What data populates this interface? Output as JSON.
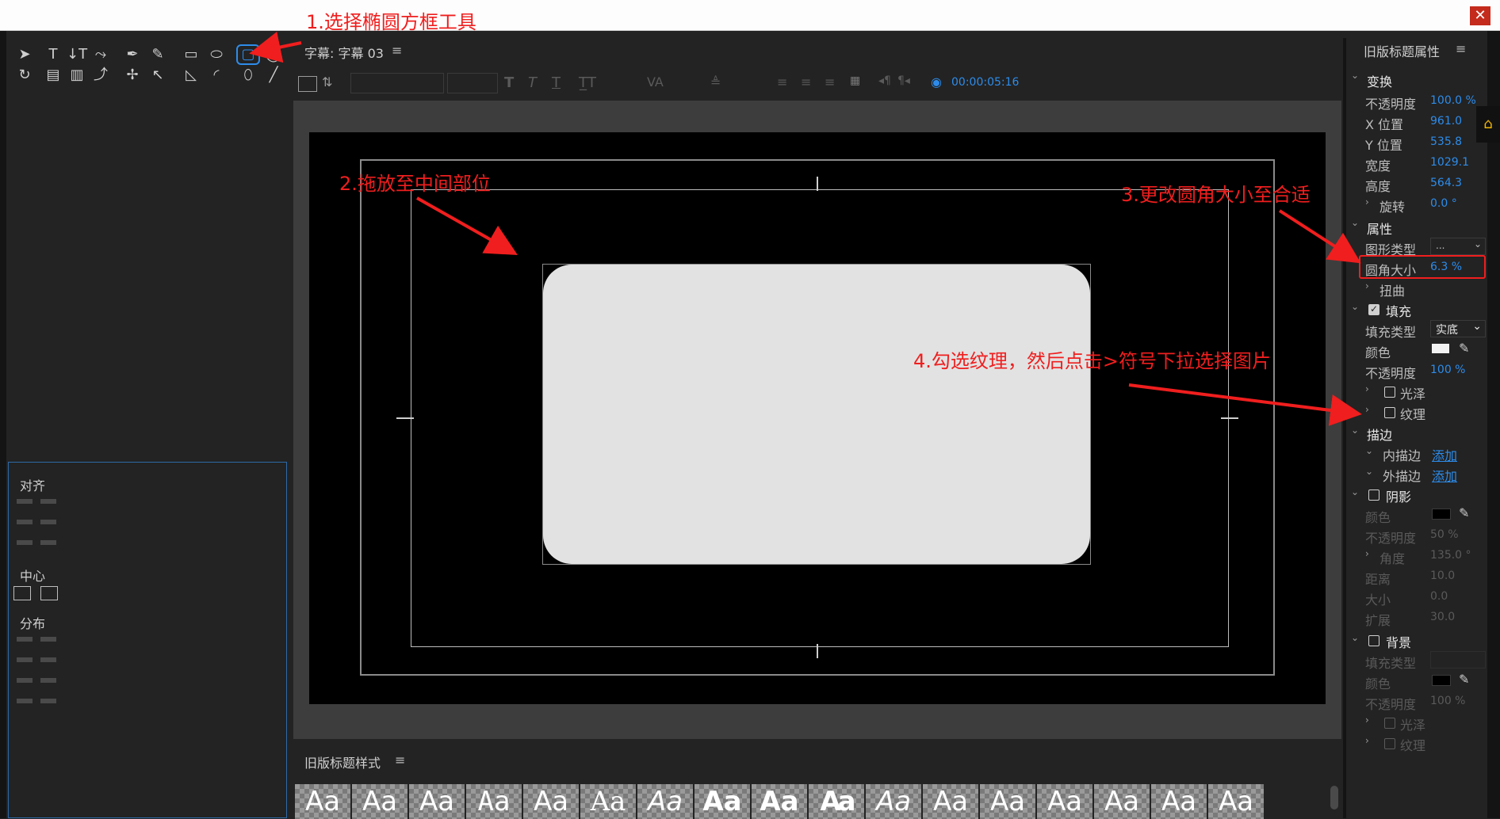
{
  "window": {
    "close_icon": "close-icon"
  },
  "annotations": {
    "step1": "1.选择椭圆方框工具",
    "step2": "2.拖放至中间部位",
    "step3": "3.更改圆角大小至合适",
    "step4": "4.勾选纹理，然后点击>符号下拉选择图片",
    "color": "#f01e1e"
  },
  "tools_panel": {
    "tools": [
      "selection-tool",
      "text-tool",
      "vertical-text-tool",
      "path-text-tool",
      "pen-tool",
      "pen-add-tool",
      "rectangle-tool",
      "clipped-rectangle-tool",
      "rounded-rectangle-tool",
      "ellipse-tool",
      "rotate-tool",
      "area-text-tool",
      "vertical-area-text-tool",
      "path-text2-tool",
      "pen-convert-tool",
      "anchor-tool",
      "wedge-tool",
      "arc-tool",
      "ellipse2-tool",
      "line-tool"
    ]
  },
  "align_panel": {
    "align_title": "对齐",
    "center_title": "中心",
    "distribute_title": "分布"
  },
  "title_panel": {
    "tab_label": "字幕: 字幕 03",
    "menu_icon": "hamburger-menu-icon",
    "timecode": "00:00:05:16",
    "accent": "#2d8ceb"
  },
  "styles_panel": {
    "title": "旧版标题样式",
    "swatches": [
      "Aa",
      "Aa",
      "Aa",
      "Aa",
      "Aa",
      "Aa",
      "Aa",
      "Aa",
      "Aa",
      "Aa",
      "Aa",
      "Aa",
      "Aa",
      "Aa",
      "Aa",
      "Aa",
      "Aa"
    ]
  },
  "properties": {
    "title": "旧版标题属性",
    "transform": {
      "label": "变换",
      "opacity_label": "不透明度",
      "opacity": "100.0 %",
      "x_label": "X 位置",
      "x": "961.0",
      "y_label": "Y 位置",
      "y": "535.8",
      "width_label": "宽度",
      "width": "1029.1",
      "height_label": "高度",
      "height": "564.3",
      "rotation_label": "旋转",
      "rotation": "0.0 °"
    },
    "attributes": {
      "label": "属性",
      "shape_type_label": "图形类型",
      "shape_type": "...",
      "corner_label": "圆角大小",
      "corner": "6.3 %",
      "distort_label": "扭曲"
    },
    "fill": {
      "label": "填充",
      "checked": true,
      "fill_type_label": "填充类型",
      "fill_type": "实底",
      "color_label": "颜色",
      "color": "#f2f2f2",
      "opacity_label": "不透明度",
      "opacity": "100 %",
      "sheen_label": "光泽",
      "texture_label": "纹理"
    },
    "stroke": {
      "label": "描边",
      "inner_label": "内描边",
      "inner_add": "添加",
      "outer_label": "外描边",
      "outer_add": "添加"
    },
    "shadow": {
      "label": "阴影",
      "color_label": "颜色",
      "color": "#000000",
      "opacity_label": "不透明度",
      "opacity": "50 %",
      "angle_label": "角度",
      "angle": "135.0 °",
      "distance_label": "距离",
      "distance": "10.0",
      "size_label": "大小",
      "size": "0.0",
      "spread_label": "扩展",
      "spread": "30.0"
    },
    "background": {
      "label": "背景",
      "fill_type_label": "填充类型",
      "color_label": "颜色",
      "color": "#000000",
      "opacity_label": "不透明度",
      "opacity": "100 %",
      "sheen_label": "光泽",
      "texture_label": "纹理"
    }
  }
}
